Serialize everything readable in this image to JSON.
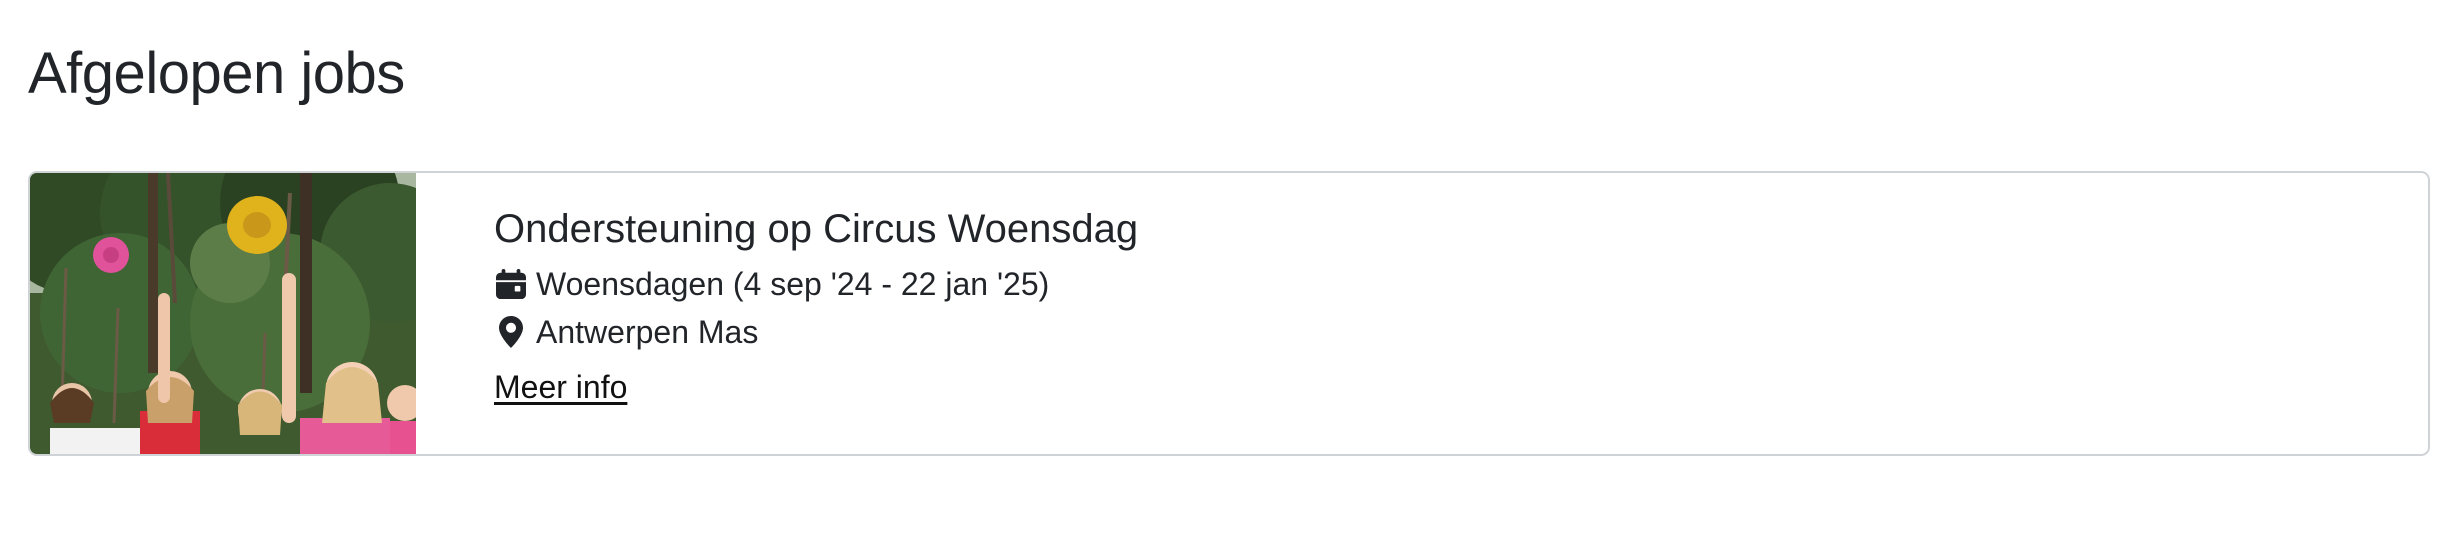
{
  "section": {
    "title": "Afgelopen jobs"
  },
  "jobs": [
    {
      "title": "Ondersteuning op Circus Woensdag",
      "schedule_icon": "calendar-icon",
      "schedule": "Woensdagen (4 sep '24 - 22 jan '25)",
      "location_icon": "map-pin-icon",
      "location": "Antwerpen Mas",
      "more_label": "Meer info"
    }
  ]
}
